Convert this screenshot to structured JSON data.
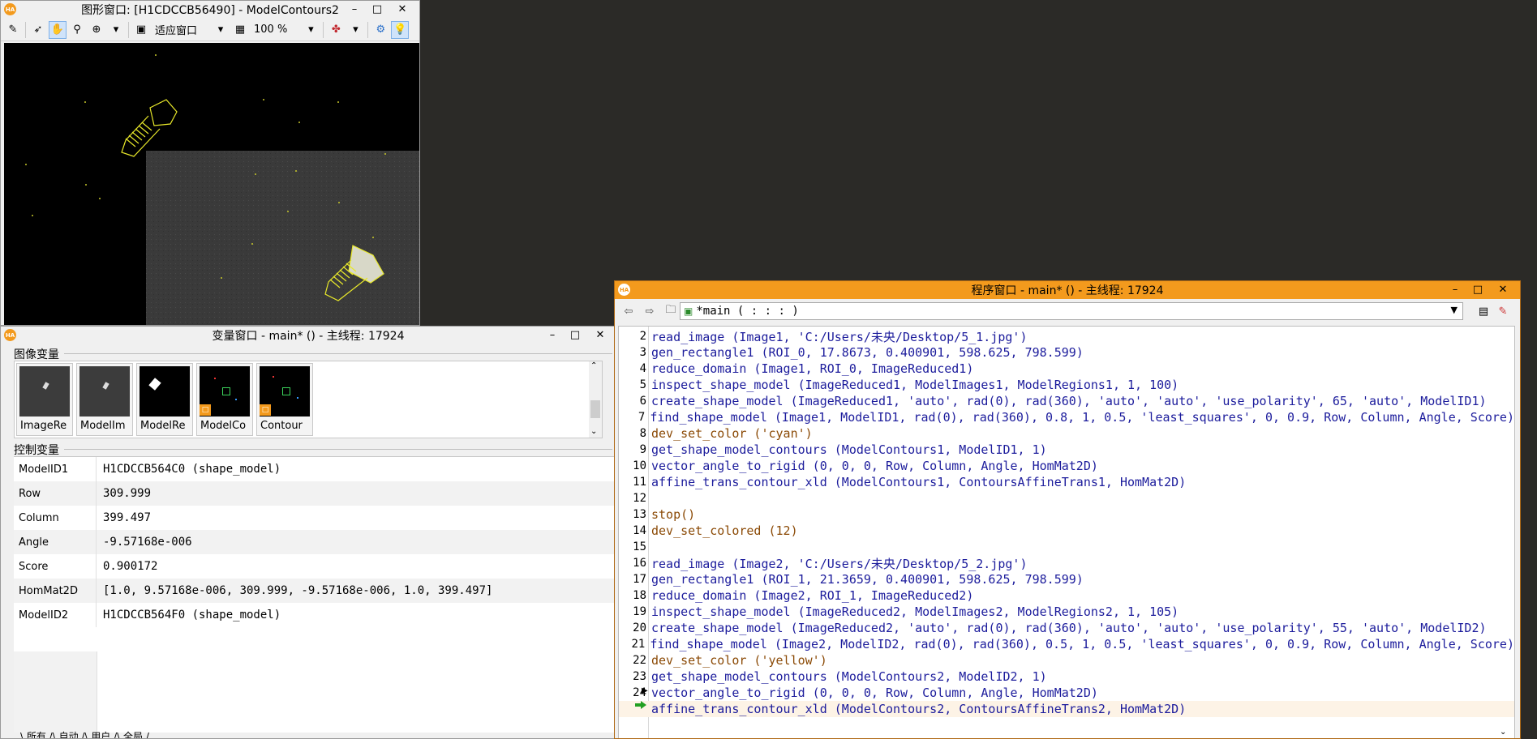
{
  "graphics_window": {
    "title": "图形窗口: [H1CDCCB56490] - ModelContours2",
    "toolbar": {
      "fit_label": "适应窗口",
      "zoom_label": "100 %"
    }
  },
  "variable_window": {
    "title": "变量窗口 - main* () - 主线程: 17924",
    "iconic_section": "图像变量",
    "control_section": "控制变量",
    "iconic_vars": [
      {
        "name": "ImageRe"
      },
      {
        "name": "ModelIm"
      },
      {
        "name": "ModelRe"
      },
      {
        "name": "ModelCo"
      },
      {
        "name": "Contour"
      }
    ],
    "control_vars": [
      {
        "name": "ModelID1",
        "value": "H1CDCCB564C0 (shape_model)"
      },
      {
        "name": "Row",
        "value": "309.999"
      },
      {
        "name": "Column",
        "value": "399.497"
      },
      {
        "name": "Angle",
        "value": "-9.57168e-006"
      },
      {
        "name": "Score",
        "value": "0.900172"
      },
      {
        "name": "HomMat2D",
        "value": "[1.0, 9.57168e-006, 309.999, -9.57168e-006, 1.0, 399.497]"
      },
      {
        "name": "ModelID2",
        "value": "H1CDCCB564F0 (shape_model)"
      }
    ],
    "bottom_tabs": "\\ 所有 /\\ 自动 /\\ 用户 /\\ 全局 /"
  },
  "program_window": {
    "title": "程序窗口 - main* () - 主线程: 17924",
    "procedure": "*main ( : : : )",
    "lines": [
      {
        "n": "2",
        "text": "read_image (Image1, 'C:/Users/未央/Desktop/5_1.jpg')",
        "kind": "op"
      },
      {
        "n": "3",
        "text": "gen_rectangle1 (ROI_0, 17.8673, 0.400901, 598.625, 798.599)",
        "kind": "op"
      },
      {
        "n": "4",
        "text": "reduce_domain (Image1, ROI_0, ImageReduced1)",
        "kind": "op"
      },
      {
        "n": "5",
        "text": "inspect_shape_model (ImageReduced1, ModelImages1, ModelRegions1, 1, 100)",
        "kind": "op"
      },
      {
        "n": "6",
        "text": "create_shape_model (ImageReduced1, 'auto', rad(0), rad(360), 'auto', 'auto', 'use_polarity', 65, 'auto', ModelID1)",
        "kind": "op"
      },
      {
        "n": "7",
        "text": "find_shape_model (Image1, ModelID1, rad(0), rad(360), 0.8, 1, 0.5, 'least_squares', 0, 0.9, Row, Column, Angle, Score)",
        "kind": "op"
      },
      {
        "n": "8",
        "text": "dev_set_color ('cyan')",
        "kind": "ctl"
      },
      {
        "n": "9",
        "text": "get_shape_model_contours (ModelContours1, ModelID1, 1)",
        "kind": "op"
      },
      {
        "n": "10",
        "text": "vector_angle_to_rigid (0, 0, 0, Row, Column, Angle, HomMat2D)",
        "kind": "op"
      },
      {
        "n": "11",
        "text": "affine_trans_contour_xld (ModelContours1, ContoursAffineTrans1, HomMat2D)",
        "kind": "op"
      },
      {
        "n": "12",
        "text": "",
        "kind": "op"
      },
      {
        "n": "13",
        "text": "stop()",
        "kind": "ctl"
      },
      {
        "n": "14",
        "text": "dev_set_colored (12)",
        "kind": "ctl"
      },
      {
        "n": "15",
        "text": "",
        "kind": "op"
      },
      {
        "n": "16",
        "text": "read_image (Image2, 'C:/Users/未央/Desktop/5_2.jpg')",
        "kind": "op"
      },
      {
        "n": "17",
        "text": "gen_rectangle1 (ROI_1, 21.3659, 0.400901, 598.625, 798.599)",
        "kind": "op"
      },
      {
        "n": "18",
        "text": "reduce_domain (Image2, ROI_1, ImageReduced2)",
        "kind": "op"
      },
      {
        "n": "19",
        "text": "inspect_shape_model (ImageReduced2, ModelImages2, ModelRegions2, 1, 105)",
        "kind": "op"
      },
      {
        "n": "20",
        "text": "create_shape_model (ImageReduced2, 'auto', rad(0), rad(360), 'auto', 'auto', 'use_polarity', 55, 'auto', ModelID2)",
        "kind": "op"
      },
      {
        "n": "21",
        "text": "find_shape_model (Image2, ModelID2, rad(0), rad(360), 0.5, 1, 0.5, 'least_squares', 0, 0.9, Row, Column, Angle, Score)",
        "kind": "op"
      },
      {
        "n": "22",
        "text": "dev_set_color ('yellow')",
        "kind": "ctl"
      },
      {
        "n": "23",
        "text": "get_shape_model_contours (ModelContours2, ModelID2, 1)",
        "kind": "op"
      },
      {
        "n": "24",
        "text": "vector_angle_to_rigid (0, 0, 0, Row, Column, Angle, HomMat2D)",
        "kind": "op"
      },
      {
        "n": "",
        "text": "affine_trans_contour_xld (ModelContours2, ContoursAffineTrans2, HomMat2D)",
        "kind": "op",
        "current": true
      }
    ]
  },
  "colors": {
    "desktop": "#2b2a27",
    "accent": "#f39a1d",
    "operator_text": "#1c1c9c",
    "control_text": "#8b4a06",
    "contour": "#e8e82a"
  },
  "icons": [
    "halcon-logo-icon",
    "pencil-icon",
    "pointer-icon",
    "hand-icon",
    "magnifier-icon",
    "zoom-in-icon",
    "fit-window-icon",
    "zoom-percent-icon",
    "color-palette-icon",
    "roi-tool-icon",
    "lightbulb-icon",
    "minimize-icon",
    "maximize-icon",
    "close-icon",
    "back-arrow-icon",
    "forward-arrow-icon",
    "folder-icon",
    "procedure-icon",
    "program-counter-arrow-icon"
  ]
}
